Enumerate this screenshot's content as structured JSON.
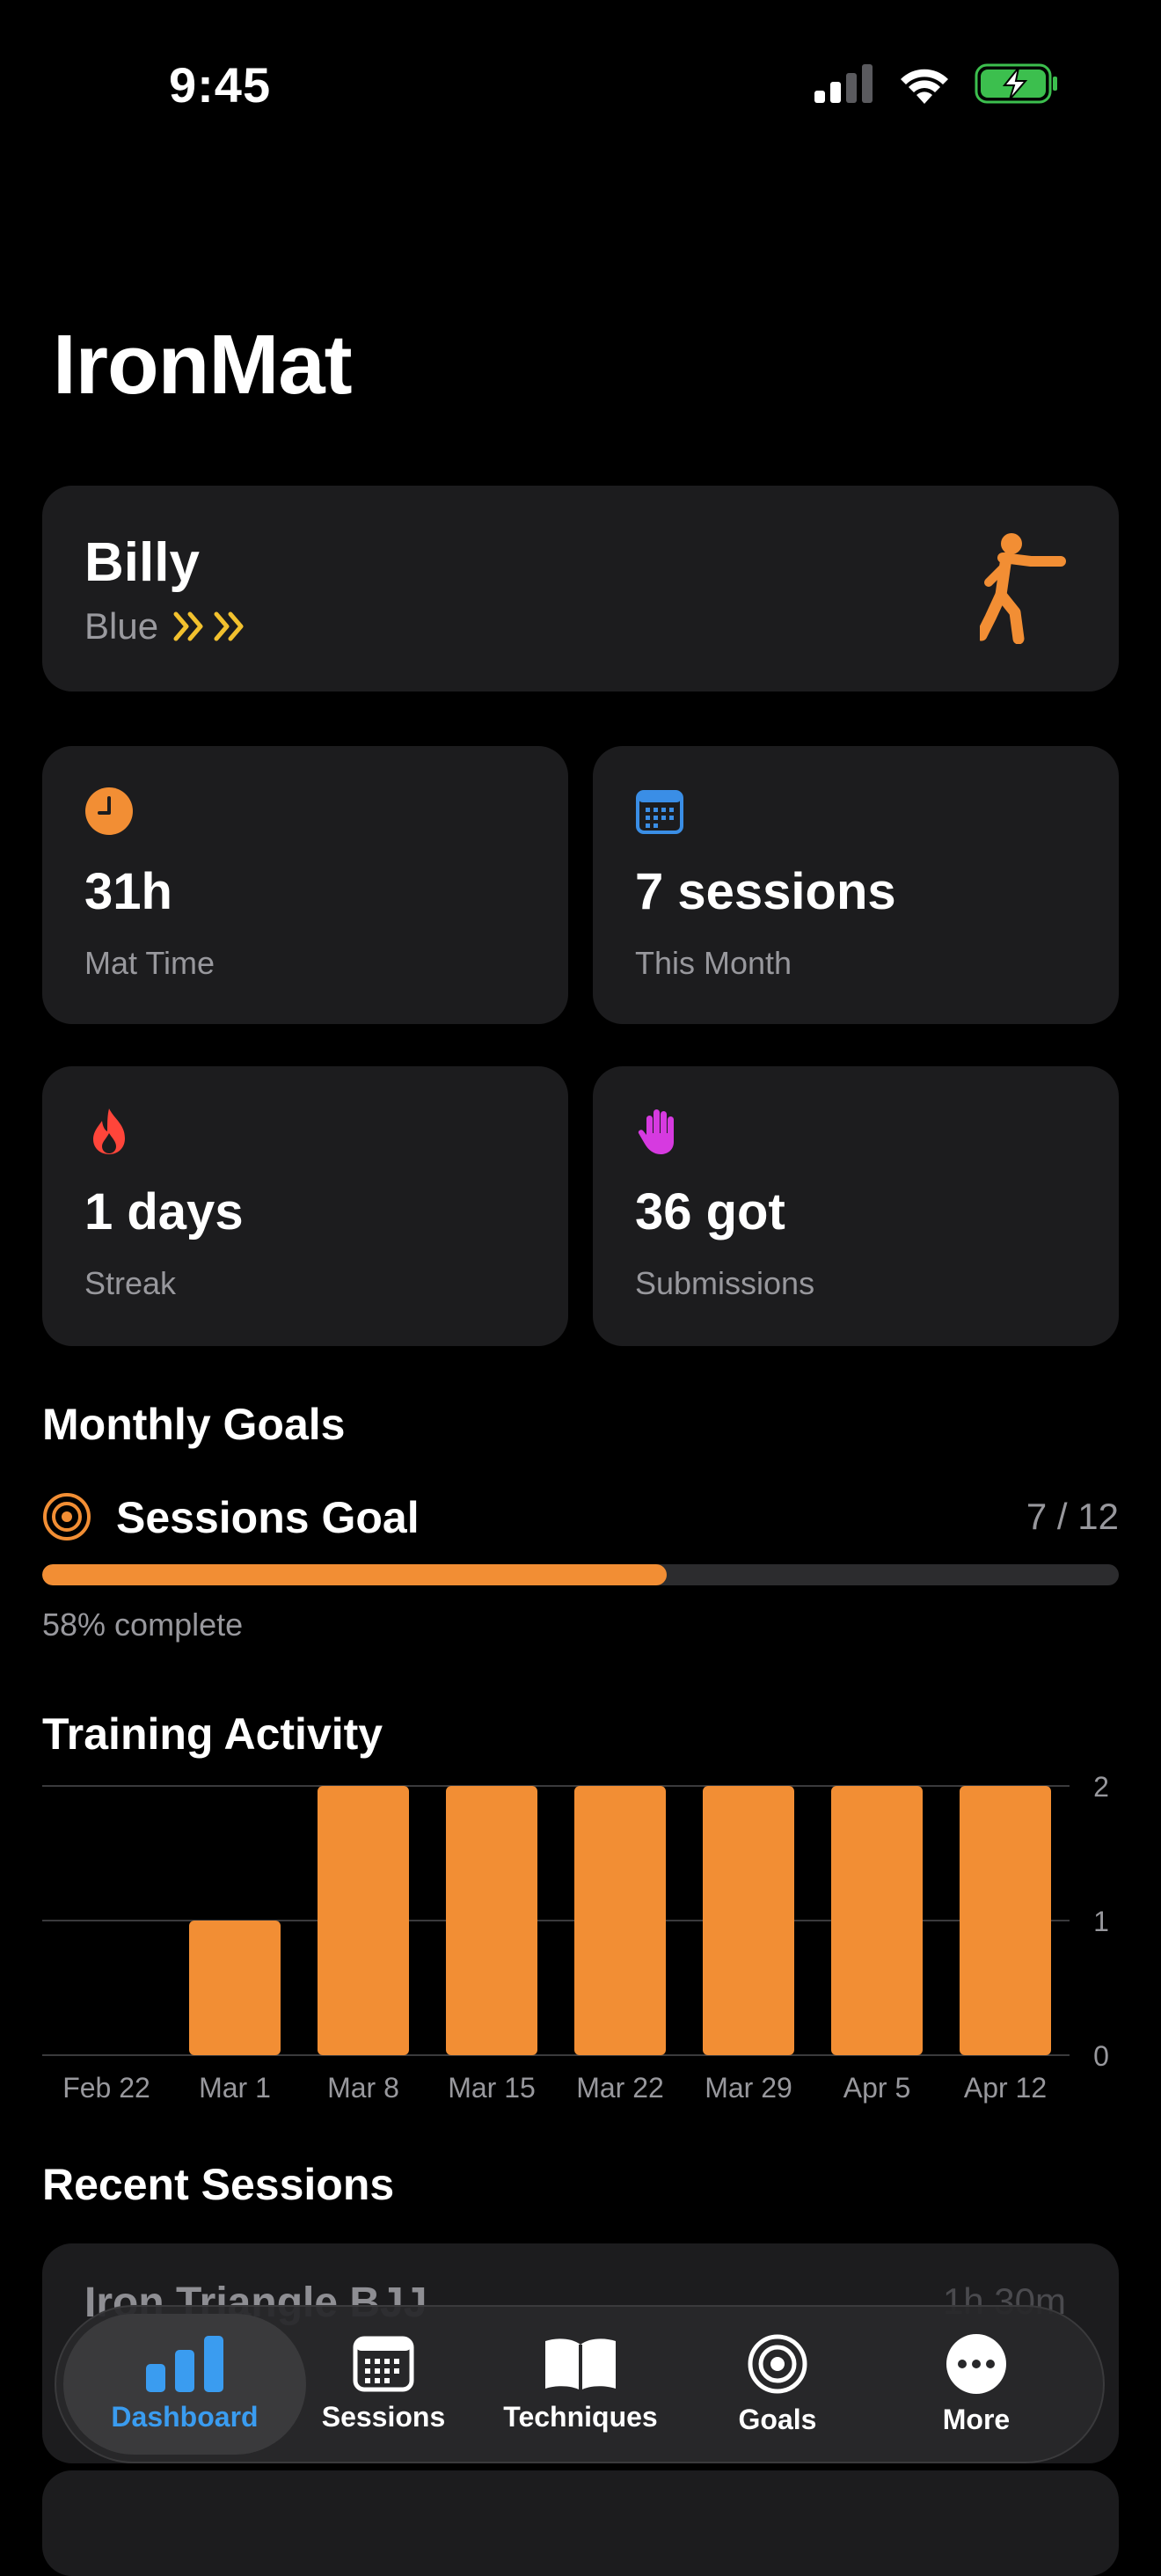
{
  "status_bar": {
    "time": "9:45"
  },
  "app": {
    "title": "IronMat"
  },
  "profile": {
    "name": "Billy",
    "belt": "Blue"
  },
  "stats": [
    {
      "icon": "clock-icon",
      "value": "31h",
      "label": "Mat Time",
      "color": "#f28e34"
    },
    {
      "icon": "calendar-icon",
      "value": "7 sessions",
      "label": "This Month",
      "color": "#3a8ee6"
    },
    {
      "icon": "flame-icon",
      "value": "1 days",
      "label": "Streak",
      "color": "#ff453a"
    },
    {
      "icon": "hand-icon",
      "value": "36 got",
      "label": "Submissions",
      "color": "#d63ae0"
    }
  ],
  "goals": {
    "section_title": "Monthly Goals",
    "name": "Sessions Goal",
    "count": "7 / 12",
    "progress": 0.58,
    "progress_text": "58% complete"
  },
  "activity": {
    "section_title": "Training Activity"
  },
  "chart_data": {
    "type": "bar",
    "categories": [
      "Feb 22",
      "Mar 1",
      "Mar 8",
      "Mar 15",
      "Mar 22",
      "Mar 29",
      "Apr 5",
      "Apr 12"
    ],
    "values": [
      0,
      1,
      2,
      2,
      2,
      2,
      2,
      2
    ],
    "ylim": [
      0,
      2
    ],
    "yticks": [
      "0",
      "1",
      "2"
    ],
    "bar_color": "#f28e34",
    "grid": true
  },
  "recent": {
    "section_title": "Recent Sessions",
    "first_title": "Iron Triangle BJJ",
    "first_meta": "1h 30m"
  },
  "tabbar": {
    "tabs": [
      {
        "label": "Dashboard",
        "icon": "chart-bars-icon"
      },
      {
        "label": "Sessions",
        "icon": "calendar-icon"
      },
      {
        "label": "Techniques",
        "icon": "book-icon"
      },
      {
        "label": "Goals",
        "icon": "target-icon"
      },
      {
        "label": "More",
        "icon": "ellipsis-icon"
      }
    ],
    "active_color": "#3a9cf0"
  }
}
